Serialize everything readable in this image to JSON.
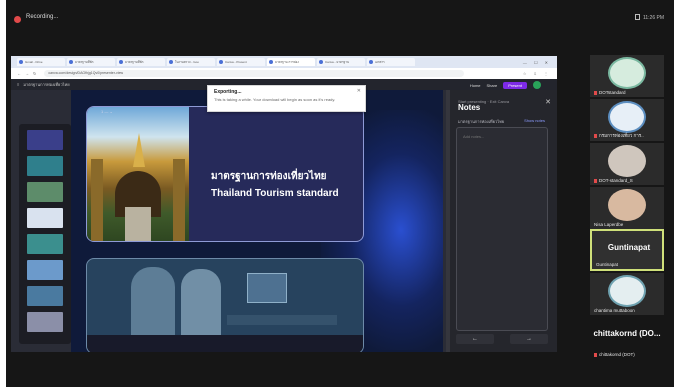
{
  "meeting": {
    "status_text": "Recording...",
    "top_right": "11:26 PM"
  },
  "browser": {
    "tabs": [
      {
        "label": "Gmail - Drive"
      },
      {
        "label": "มาตรฐานที่พัก"
      },
      {
        "label": "มาตรฐานที่พัก"
      },
      {
        "label": "ใบงานตรวจ - Goo"
      },
      {
        "label": "Canva - Present"
      },
      {
        "label": "มาตรฐาน การท่อง"
      },
      {
        "label": "Canva - มาตรฐาน"
      },
      {
        "label": "เอกสาร"
      }
    ],
    "url": "canva.com/design/DAGfhjg1Qv0/presenter-view",
    "window_controls": "— ☐ ✕",
    "tools": "☆ ⇩ ⋮"
  },
  "canva": {
    "doc_title": "มาตรฐานการท่องเที่ยวไทย",
    "buttons": {
      "home": "Home",
      "share": "Share",
      "present": "Present"
    }
  },
  "toast": {
    "title": "Exporting...",
    "body": "This is taking a while. Your download will begin as soon as it's ready."
  },
  "slides": {
    "slide1_tag": "1 — ⌄",
    "slide1_title": "มาตรฐานการท่องเที่ยวไทย",
    "slide1_subtitle": "Thailand Tourism standard"
  },
  "notes": {
    "header": "Start presenting · Exit Canva",
    "title": "Notes",
    "close": "✕",
    "slide_label": "มาตรฐานการท่องเที่ยวไทย",
    "link": "Show notes",
    "placeholder": "Add notes...",
    "prev": "←",
    "next": "→"
  },
  "participants": [
    {
      "name": "DOTstandard",
      "variant": "logo"
    },
    {
      "name": "กรมการท่องเที่ยว การ..",
      "variant": "logo"
    },
    {
      "name": "DOT-standard_S",
      "variant": "face"
    },
    {
      "name": "Nisa Laperdbe",
      "variant": "person"
    },
    {
      "name": "Guntinapat",
      "variant": "active",
      "big_name": "Guntinapat"
    },
    {
      "name": "chantima muttaboon",
      "variant": "logo"
    },
    {
      "name": "chittakornd (DOT)",
      "variant": "plain",
      "big_name": "chittakornd (DO..."
    }
  ],
  "colors": {
    "accent": "#7d2ae8",
    "active_speaker_border": "#cfe07a",
    "recording": "#e14a4a"
  }
}
